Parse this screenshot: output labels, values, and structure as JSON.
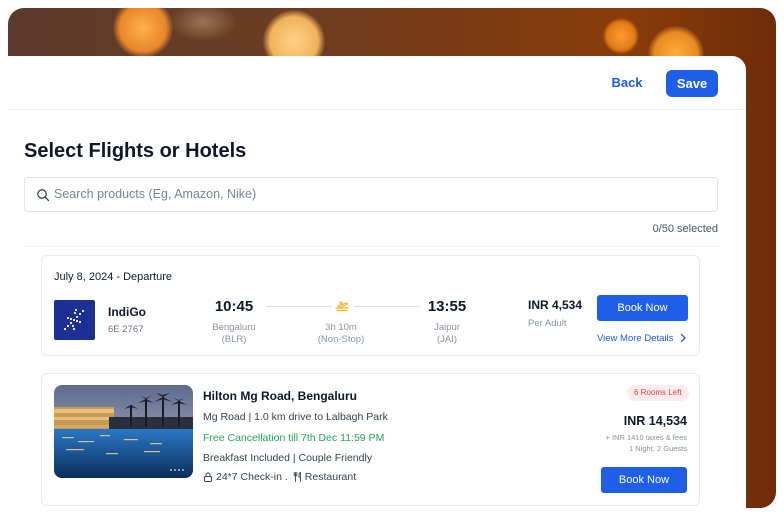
{
  "header": {
    "back_label": "Back",
    "save_label": "Save"
  },
  "page": {
    "title": "Select Flights or Hotels"
  },
  "search": {
    "placeholder": "Search products (Eg, Amazon, Nike)"
  },
  "selection": {
    "count_text": "0/50 selected"
  },
  "flight": {
    "date_label": "July 8, 2024 - Departure",
    "airline": "IndiGo",
    "flight_number": "6E 2767",
    "departure": {
      "time": "10:45",
      "city": "Bengaluru",
      "code": "(BLR)"
    },
    "arrival": {
      "time": "13:55",
      "city": "Jaipur",
      "code": "(JAI)"
    },
    "duration": "3h 10m",
    "stops": "(Non-Stop)",
    "price": "INR 4,534",
    "price_note": "Per Adult",
    "book_label": "Book Now",
    "details_label": "View More Details",
    "icons": {
      "plane": "plane-icon",
      "chevron": "chevron-right-icon"
    },
    "colors": {
      "logo_bg": "#1b2f94",
      "plane": "#f2b21b"
    }
  },
  "hotel": {
    "name": "Hilton Mg Road, Bengaluru",
    "location": "Mg Road | 1.0 km drive to Lalbagh Park",
    "cancellation": "Free Cancellation till 7th Dec 11:59 PM",
    "features": "Breakfast Included | Couple Friendly",
    "amenity_checkin": "24*7 Check-in .",
    "amenity_restaurant": "Restaurant",
    "rooms_left": "6 Rooms Left",
    "price": "INR 14,534",
    "taxes": "+ INR 1410 taxes & fees",
    "stay": "1 Night, 2 Guests",
    "book_label": "Book Now",
    "icons": {
      "lock": "lock-icon",
      "restaurant": "restaurant-icon"
    }
  },
  "colors": {
    "primary": "#1f5fe8",
    "success": "#22a55a",
    "badge_bg": "#fdecec",
    "badge_text": "#d64545"
  }
}
